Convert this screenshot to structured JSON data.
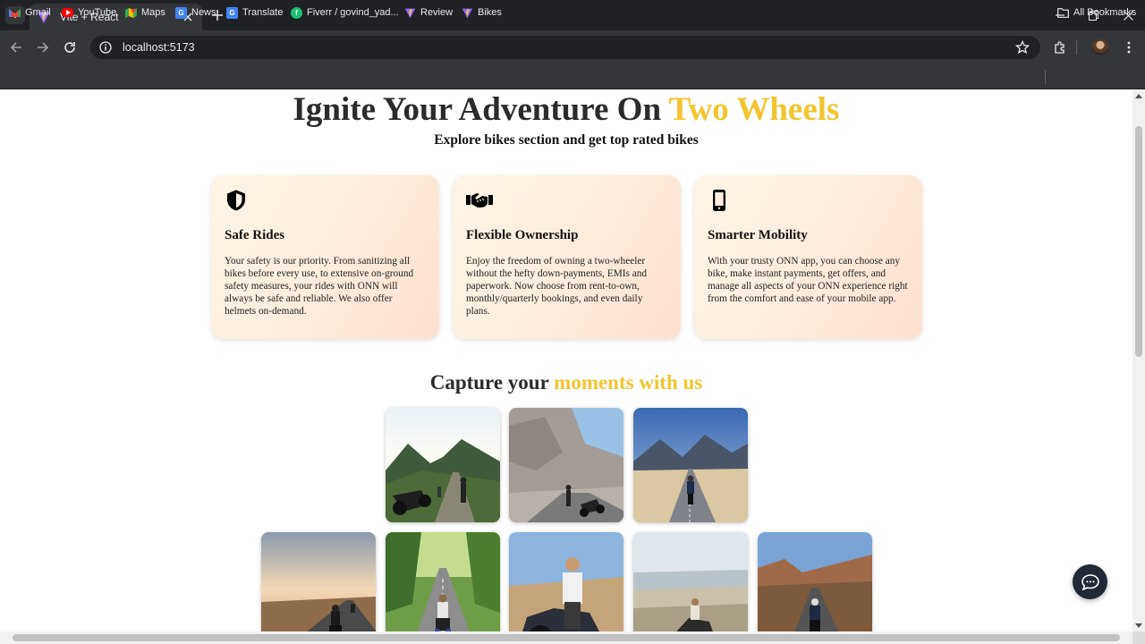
{
  "browser": {
    "tab_title": "Vite + React",
    "url": "localhost:5173",
    "bookmarks": [
      {
        "label": "Gmail",
        "icon": "gmail-icon"
      },
      {
        "label": "YouTube",
        "icon": "youtube-icon"
      },
      {
        "label": "Maps",
        "icon": "maps-icon"
      },
      {
        "label": "News",
        "icon": "news-icon"
      },
      {
        "label": "Translate",
        "icon": "translate-icon"
      },
      {
        "label": "Fiverr / govind_yad...",
        "icon": "fiverr-icon"
      },
      {
        "label": "Review",
        "icon": "vite-icon"
      },
      {
        "label": "Bikes",
        "icon": "vite-icon"
      }
    ],
    "all_bookmarks_label": "All Bookmarks"
  },
  "hero": {
    "title_main": "Ignite Your Adventure On ",
    "title_accent": "Two Wheels",
    "subtitle": "Explore bikes section and get top rated bikes"
  },
  "features": [
    {
      "icon": "shield-icon",
      "title": "Safe Rides",
      "text": "Your safety is our priority. From sanitizing all bikes before every use, to extensive on-ground safety measures, your rides with ONN will always be safe and reliable. We also offer helmets on-demand."
    },
    {
      "icon": "handshake-icon",
      "title": "Flexible Ownership",
      "text": "Enjoy the freedom of owning a two-wheeler without the hefty down-payments, EMIs and paperwork. Now choose from rent-to-own, monthly/quarterly bookings, and even daily plans."
    },
    {
      "icon": "mobile-phone-icon",
      "title": "Smarter Mobility",
      "text": "With your trusty ONN app, you can choose any bike, make instant payments, get offers, and manage all aspects of your ONN experience right from the comfort and ease of your mobile app."
    }
  ],
  "gallery": {
    "title_main": "Capture your ",
    "title_accent": "moments with us"
  },
  "colors": {
    "accent": "#f4c430",
    "heading": "#2b2b2b",
    "card_gradient_start": "#fdf5e6",
    "card_gradient_end": "#fde0cf",
    "chat_button": "#1f2a36"
  }
}
